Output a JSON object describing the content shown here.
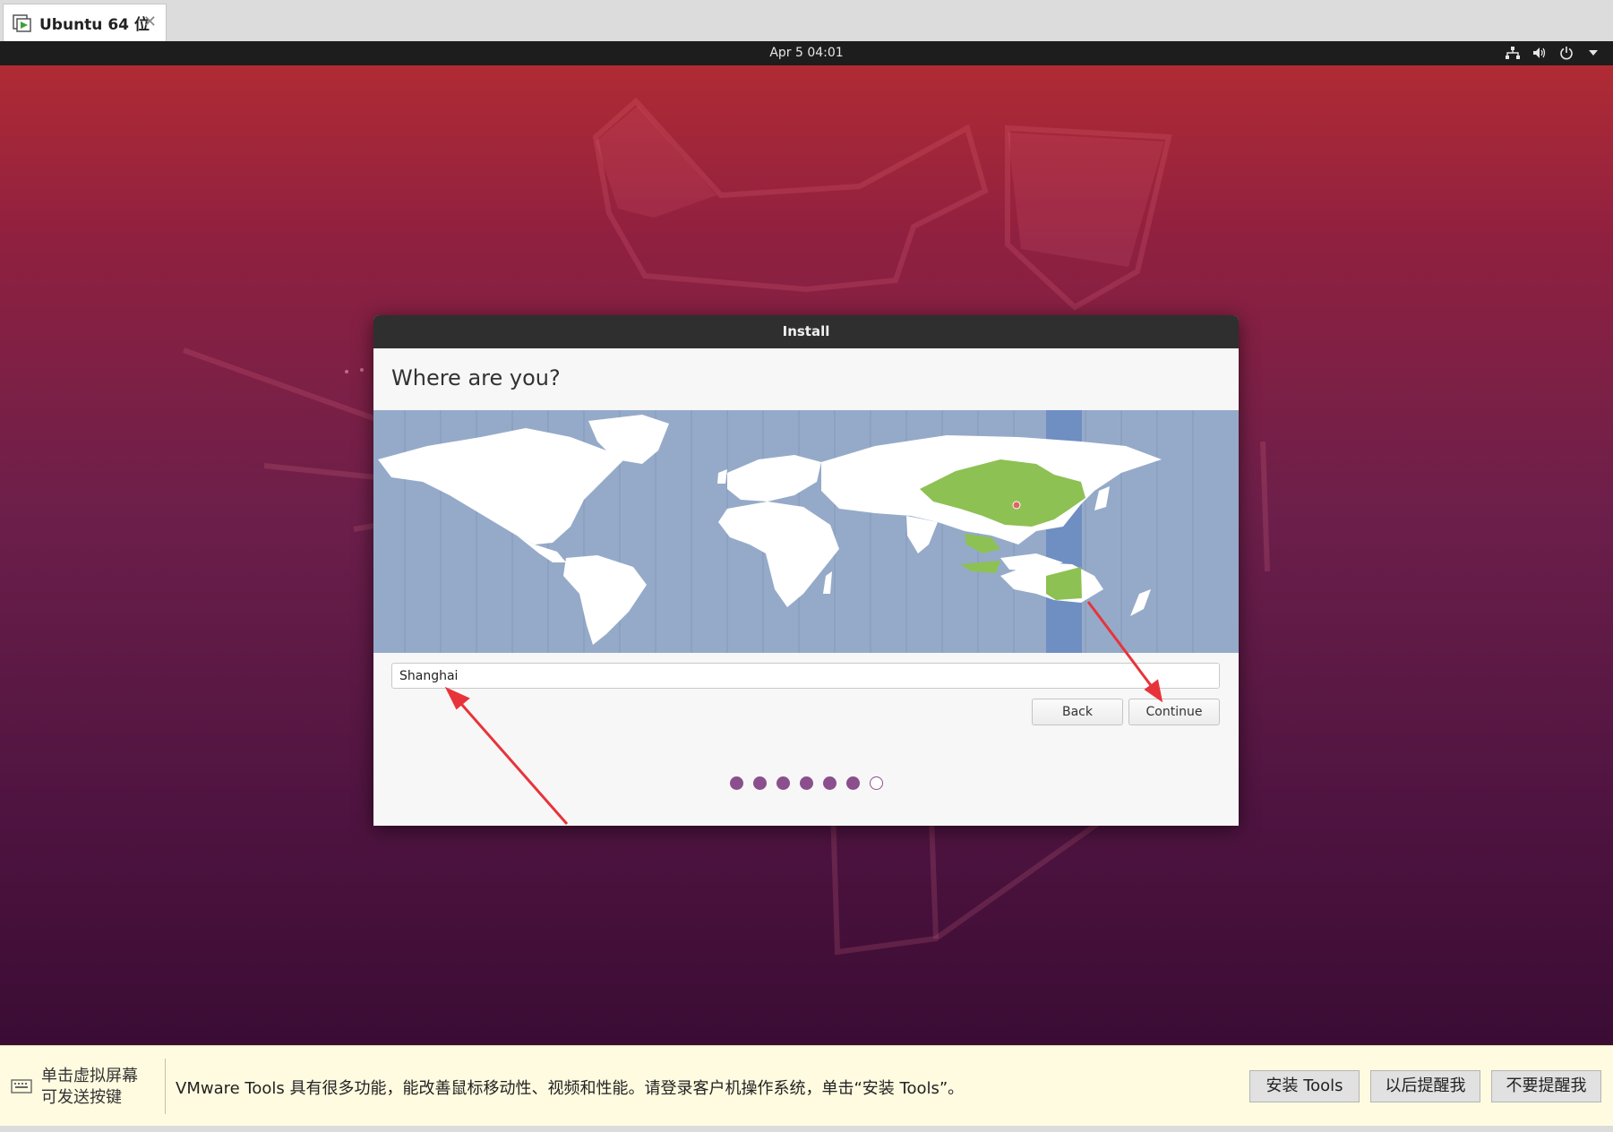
{
  "vmware": {
    "tab_title": "Ubuntu 64 位",
    "tab_icon": "vm-play-icon",
    "close_glyph": "✕"
  },
  "topbar": {
    "clock": "Apr 5  04:01",
    "tray_icons": [
      "network-icon",
      "volume-icon",
      "power-icon",
      "chevron-down-icon"
    ]
  },
  "dialog": {
    "title": "Install",
    "heading": "Where are you?",
    "timezone_value": "Shanghai",
    "back_label": "Back",
    "continue_label": "Continue",
    "progress": {
      "total": 7,
      "completed": 6
    }
  },
  "banner": {
    "hint_line1": "单击虚拟屏幕",
    "hint_line2": "可发送按键",
    "message": "VMware Tools 具有很多功能，能改善鼠标移动性、视频和性能。请登录客户机操作系统，单击“安装 Tools”。",
    "install_label": "安装 Tools",
    "later_label": "以后提醒我",
    "never_label": "不要提醒我"
  },
  "colors": {
    "accent": "#8b4f8d",
    "map_ocean": "#95aac9",
    "selected_zone": "#8dc153",
    "annotation_arrow": "#e8333a"
  }
}
